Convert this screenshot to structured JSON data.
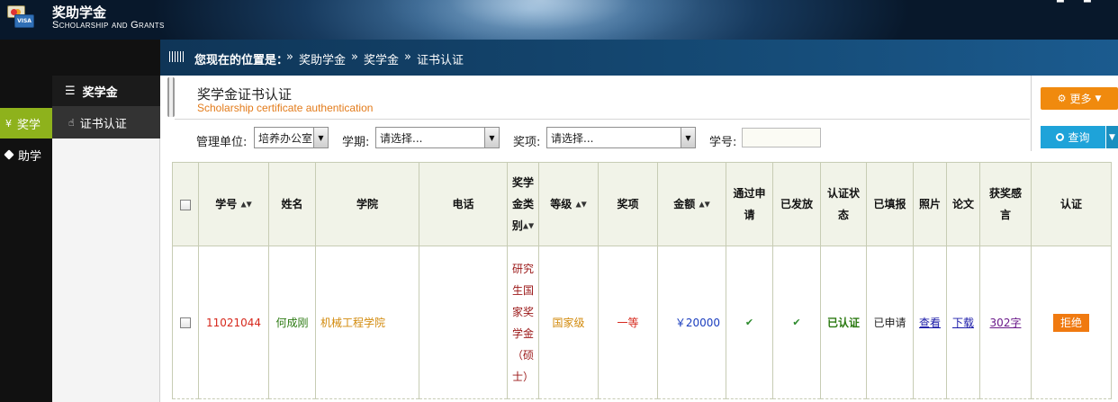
{
  "app": {
    "title": "奖助学金",
    "subtitle": "Scholarship and Grants",
    "win_min": "▀",
    "win_max": "▀"
  },
  "breadcrumb": {
    "label": "您现在的位置是：",
    "items": [
      "奖助学金",
      "奖学金",
      "证书认证"
    ],
    "separator": "»"
  },
  "sidebar": {
    "primary": [
      {
        "label": "奖学",
        "icon": "yen-icon",
        "glyph": "¥",
        "active": true
      },
      {
        "label": "助学",
        "icon": "tag-icon",
        "glyph": "▶",
        "active": false
      }
    ],
    "section": {
      "label": "奖学金",
      "icon_glyph": "☰"
    },
    "items": [
      {
        "label": "证书认证",
        "icon_glyph": "👍"
      }
    ]
  },
  "page": {
    "title": "奖学金证书认证",
    "subtitle": "Scholarship certificate authentication"
  },
  "toolbar": {
    "more_label": "更多",
    "query_label": "查询"
  },
  "filters": {
    "unit_label": "管理单位:",
    "unit_value": "培养办公室",
    "term_label": "学期:",
    "term_value": "请选择...",
    "award_label": "奖项:",
    "award_value": "请选择...",
    "stuno_label": "学号:",
    "stuno_value": ""
  },
  "table": {
    "headers": {
      "stuno": "学号",
      "name": "姓名",
      "college": "学院",
      "phone": "电话",
      "category": [
        "奖学",
        "金类",
        "别"
      ],
      "grade": "等级",
      "award": "奖项",
      "amount": "金额",
      "passed": [
        "通过申",
        "请"
      ],
      "issued": "已发放",
      "auth_status": [
        "认证状",
        "态"
      ],
      "filled": "已填报",
      "photo": "照片",
      "thesis": "论文",
      "feeling": [
        "获奖感",
        "言"
      ],
      "certify": "认证"
    },
    "rows": [
      {
        "stuno": "11021044",
        "name": "何成刚",
        "college": "机械工程学院",
        "phone": "",
        "category": [
          "研究",
          "生国",
          "家奖",
          "学金",
          "（硕",
          "士）"
        ],
        "grade": "国家级",
        "award": "一等",
        "amount": "￥20000",
        "passed": "✔",
        "issued": "✔",
        "auth_status": "已认证",
        "filled": "已申请",
        "photo": "查看",
        "thesis": "下载",
        "feeling": "302字",
        "certify": "拒绝"
      }
    ]
  }
}
